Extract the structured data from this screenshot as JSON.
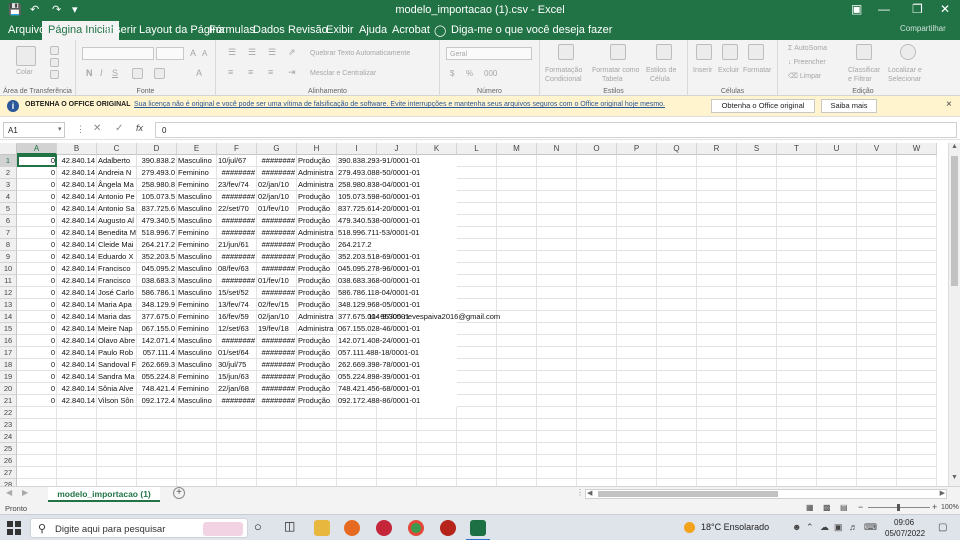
{
  "window": {
    "title": "modelo_importacao (1).csv  -  Excel",
    "share": "Compartilhar"
  },
  "tabs": [
    "Arquivo",
    "Página Inicial",
    "Inserir",
    "Layout da Página",
    "Fórmulas",
    "Dados",
    "Revisão",
    "Exibir",
    "Ajuda",
    "Acrobat"
  ],
  "tell_me": "Diga-me o que você deseja fazer",
  "ribbon": {
    "paste": "Colar",
    "clipboard": "Área de Transferência",
    "font": "Fonte",
    "alignment": "Alinhamento",
    "wrap": "Quebrar Texto Automaticamente",
    "merge": "Mesclar e Centralizar",
    "number_format": "Geral",
    "number": "Número",
    "cond_format": [
      "Formatação",
      "Condicional"
    ],
    "format_table": [
      "Formatar como",
      "Tabela"
    ],
    "cell_styles": [
      "Estilos de",
      "Célula"
    ],
    "styles": "Estilos",
    "insert": "Inserir",
    "delete": "Excluir",
    "format": "Formatar",
    "cells": "Células",
    "autosum": "AutoSoma",
    "fill": "Preencher",
    "clear": "Limpar",
    "sort": [
      "Classificar",
      "e Filtrar"
    ],
    "find": [
      "Localizar e",
      "Selecionar"
    ],
    "editing": "Edição"
  },
  "message_bar": {
    "title": "OBTENHA O OFFICE ORIGINAL",
    "text": "Sua licença não é original e você pode ser uma vítima de falsificação de software. Evite interrupções e mantenha seus arquivos seguros com o Office original hoje mesmo.",
    "btn1": "Obtenha o Office original",
    "btn2": "Saiba mais",
    "close": "×"
  },
  "formula_bar": {
    "name_box": "A1",
    "fx": "fx",
    "value": "0"
  },
  "grid": {
    "columns": [
      "A",
      "B",
      "C",
      "D",
      "E",
      "F",
      "G",
      "H",
      "I",
      "J",
      "K",
      "L",
      "M",
      "N",
      "O",
      "P",
      "Q",
      "R",
      "S",
      "T",
      "U",
      "V",
      "W"
    ],
    "row_numbers": [
      "1",
      "2",
      "3",
      "4",
      "5",
      "6",
      "7",
      "8",
      "9",
      "10",
      "11",
      "12",
      "13",
      "14",
      "15",
      "16",
      "17",
      "18",
      "19",
      "20",
      "21",
      "22",
      "23",
      "24",
      "25",
      "26",
      "27",
      "28"
    ],
    "rows": [
      [
        "0",
        "42.840.14",
        "Adalberto",
        "390.838.2",
        "Masculino",
        "10/jul/67",
        "########",
        "Produção",
        "390.838.293-91/0001-01"
      ],
      [
        "0",
        "42.840.14",
        "Andreia N",
        "279.493.0",
        "Feminino",
        "########",
        "########",
        "Administra",
        "279.493.088-50/0001-01"
      ],
      [
        "0",
        "42.840.14",
        "Ângela Ma",
        "258.980.8",
        "Feminino",
        "23/fev/74",
        "02/jan/10",
        "Administra",
        "258.980.838-04/0001-01"
      ],
      [
        "0",
        "42.840.14",
        "Antonio Pe",
        "105.073.5",
        "Masculino",
        "########",
        "02/jan/10",
        "Produção",
        "105.073.598-60/0001-01"
      ],
      [
        "0",
        "42.840.14",
        "Antonio Sa",
        "837.725.6",
        "Masculino",
        "22/set/70",
        "01/fev/10",
        "Produção",
        "837.725.614-20/0001-01"
      ],
      [
        "0",
        "42.840.14",
        "Augusto Al",
        "479.340.5",
        "Masculino",
        "########",
        "########",
        "Produção",
        "479.340.538-00/0001-01"
      ],
      [
        "0",
        "42.840.14",
        "Benedita M",
        "518.996.7",
        "Feminino",
        "########",
        "########",
        "Administra",
        "518.996.711-53/0001-01"
      ],
      [
        "0",
        "42.840.14",
        "Cleide Mai",
        "264.217.2",
        "Feminino",
        "21/jun/61",
        "########",
        "Produção",
        "264.217.2"
      ],
      [
        "0",
        "42.840.14",
        "Eduardo X",
        "352.203.5",
        "Masculino",
        "########",
        "########",
        "Produção",
        "352.203.518-69/0001-01"
      ],
      [
        "0",
        "42.840.14",
        "Francisco",
        "045.095.2",
        "Masculino",
        "08/fev/63",
        "########",
        "Produção",
        "045.095.278-96/0001-01"
      ],
      [
        "0",
        "42.840.14",
        "Francisco",
        "038.683.3",
        "Masculino",
        "########",
        "01/fev/10",
        "Produção",
        "038.683.368-00/0001-01"
      ],
      [
        "0",
        "42.840.14",
        "José Carlo",
        "586.786.1",
        "Masculino",
        "15/set/52",
        "########",
        "Produção",
        "586.786.118-04/0001-01"
      ],
      [
        "0",
        "42.840.14",
        "Maria Apa",
        "348.129.9",
        "Feminino",
        "13/fev/74",
        "02/fev/15",
        "Produção",
        "348.129.968-05/0001-01"
      ],
      [
        "0",
        "42.840.14",
        "Maria das",
        "377.675.0",
        "Feminino",
        "16/fev/59",
        "02/jan/10",
        "Administra",
        "377.675.004-97/0001",
        "11- 95305-nevespaiva2016@gmail.com"
      ],
      [
        "0",
        "42.840.14",
        "Meire Nap",
        "067.155.0",
        "Feminino",
        "12/set/63",
        "19/fev/18",
        "Administra",
        "067.155.028-46/0001-01"
      ],
      [
        "0",
        "42.840.14",
        "Olavo Abre",
        "142.071.4",
        "Masculino",
        "########",
        "########",
        "Produção",
        "142.071.408-24/0001-01"
      ],
      [
        "0",
        "42.840.14",
        "Paulo Rob",
        "057.111.4",
        "Masculino",
        "01/set/64",
        "########",
        "Produção",
        "057.111.488-18/0001-01"
      ],
      [
        "0",
        "42.840.14",
        "Sandoval F",
        "262.669.3",
        "Masculino",
        "30/jul/75",
        "########",
        "Produção",
        "262.669.398-78/0001-01"
      ],
      [
        "0",
        "42.840.14",
        "Sandra Ma",
        "055.224.8",
        "Feminino",
        "15/jun/63",
        "########",
        "Produção",
        "055.224.898-39/0001-01"
      ],
      [
        "0",
        "42.840.14",
        "Sônia Alve",
        "748.421.4",
        "Feminino",
        "22/jan/68",
        "########",
        "Produção",
        "748.421.456-68/0001-01"
      ],
      [
        "0",
        "42.840.14",
        "Vilson Sôn",
        "092.172.4",
        "Masculino",
        "########",
        "########",
        "Produção",
        "092.172.488-86/0001-01"
      ]
    ]
  },
  "sheet": {
    "tab": "modelo_importacao (1)",
    "add": "+"
  },
  "status": {
    "ready": "Pronto",
    "zoom": "100%"
  },
  "taskbar": {
    "search": "Digite aqui para pesquisar",
    "weather": "18°C  Ensolarado",
    "time": "09:06",
    "date": "05/07/2022"
  }
}
